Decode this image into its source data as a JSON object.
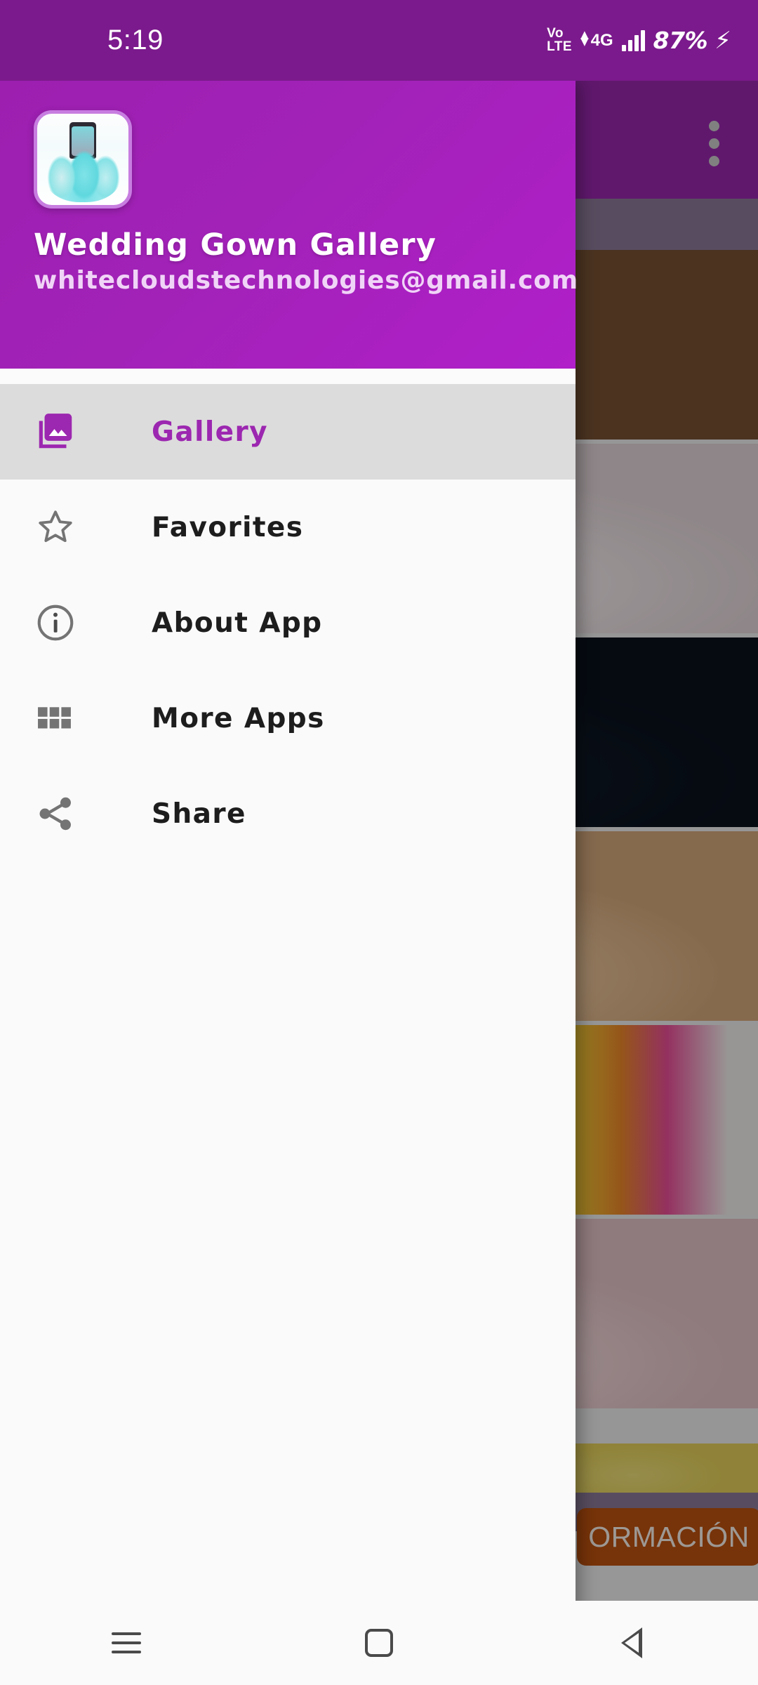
{
  "status_bar": {
    "time": "5:19",
    "volte_line1": "Vo",
    "volte_line2": "LTE",
    "network": "4G",
    "battery": "87%",
    "charging_icon": "bolt-icon",
    "signal_icon": "signal-bars-icon"
  },
  "drawer": {
    "app_icon_name": "app-icon-wedding-gown",
    "title": "Wedding Gown Gallery",
    "email": "whitecloudstechnologies@gmail.com",
    "menu": [
      {
        "id": "gallery",
        "label": "Gallery",
        "icon": "photo-library-icon",
        "selected": true
      },
      {
        "id": "favorites",
        "label": "Favorites",
        "icon": "star-outline-icon",
        "selected": false
      },
      {
        "id": "about",
        "label": "About App",
        "icon": "info-circle-icon",
        "selected": false
      },
      {
        "id": "moreapps",
        "label": "More Apps",
        "icon": "grid-apps-icon",
        "selected": false
      },
      {
        "id": "share",
        "label": "Share",
        "icon": "share-nodes-icon",
        "selected": false
      }
    ]
  },
  "content": {
    "overflow_menu_icon": "overflow-dots-icon",
    "thumbnails": [
      {
        "name": "gown-thumb-red-ballgown"
      },
      {
        "name": "gown-thumb-white-ballgown"
      },
      {
        "name": "gown-thumb-navy-ballgown"
      },
      {
        "name": "gown-thumb-peach-ballgown"
      },
      {
        "name": "gown-thumb-rainbow-ballgowns"
      },
      {
        "name": "gown-thumb-pink-ballgown"
      }
    ],
    "ad_button_label": "ORMACIÓN"
  },
  "nav_bar": {
    "recents_icon": "recents-icon",
    "home_icon": "home-icon",
    "back_icon": "back-icon"
  },
  "colors": {
    "primary_purple": "#9c27b0",
    "status_bar_purple": "#7b1a8c",
    "drawer_header_purple": "#a222b8",
    "selected_row_gray": "#dcdcdc",
    "ad_orange": "#c0530f"
  }
}
